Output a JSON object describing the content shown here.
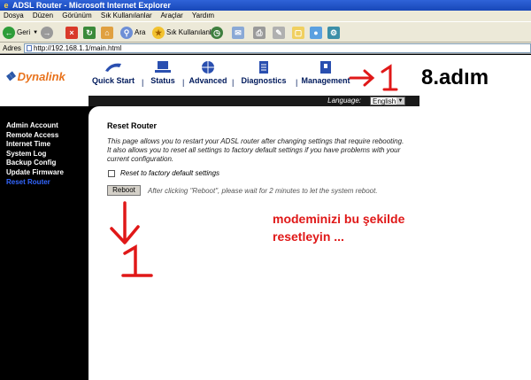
{
  "browser": {
    "title": "ADSL Router - Microsoft Internet Explorer",
    "menu": [
      "Dosya",
      "Düzen",
      "Görünüm",
      "Sık Kullanılanlar",
      "Araçlar",
      "Yardım"
    ],
    "toolbar": {
      "back_label": "Geri",
      "search_label": "Ara",
      "favorites_label": "Sık Kullanılanlar"
    },
    "address_label": "Adres",
    "address_url": "http://192.168.1.1/main.html"
  },
  "router": {
    "brand": "Dynalink",
    "nav": [
      "Quick Start",
      "Status",
      "Advanced",
      "Diagnostics",
      "Management"
    ],
    "nav_separator": "|",
    "language_label": "Language:",
    "language_value": "English",
    "sidebar": [
      "Admin Account",
      "Remote Access",
      "Internet Time",
      "System Log",
      "Backup Config",
      "Update Firmware",
      "Reset Router"
    ],
    "active_sidebar_item": "Reset Router",
    "page_title": "Reset Router",
    "description": "This page allows you to restart your ADSL router after changing settings that require rebooting. It also allows you to reset all settings to factory default settings if you have problems with your current configuration.",
    "checkbox_label": "Reset to factory default settings",
    "reboot_label": "Reboot",
    "reboot_note": "After clicking \"Reboot\", please wait for 2 minutes to let the system reboot."
  },
  "annotations": {
    "step": "8.adım",
    "number": "1",
    "instruction_line1": "modeminizi bu şekilde",
    "instruction_line2": "resetleyin ..."
  },
  "colors": {
    "brand_orange": "#e8721c",
    "nav_blue": "#001a5c",
    "annotation_red": "#e01818",
    "active_blue": "#3366ff"
  }
}
